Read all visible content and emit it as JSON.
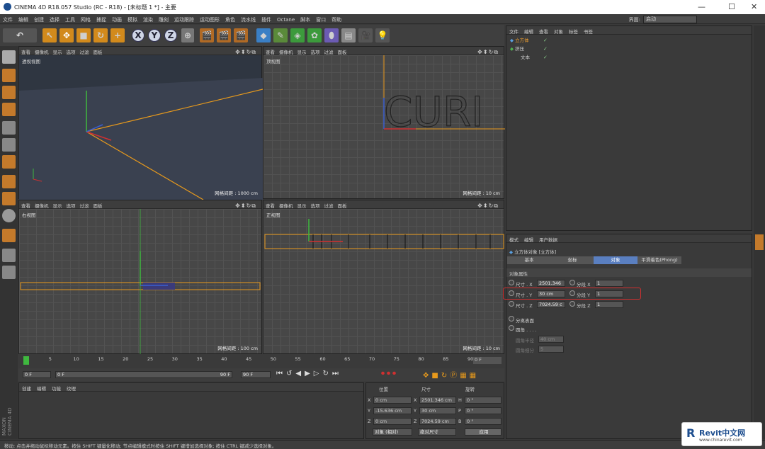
{
  "titlebar": {
    "title": "CINEMA 4D R18.057 Studio (RC - R18) - [未标题 1 *] - 主要",
    "minimize": "—",
    "maximize": "☐",
    "close": "✕"
  },
  "menu": [
    "文件",
    "编辑",
    "创建",
    "选择",
    "工具",
    "网格",
    "捕捉",
    "动画",
    "模拟",
    "渲染",
    "雕刻",
    "运动跟踪",
    "运动图形",
    "角色",
    "流水线",
    "插件",
    "Octane",
    "脚本",
    "窗口",
    "帮助"
  ],
  "layout": {
    "label": "界面:",
    "value": "启动"
  },
  "toolbar": {
    "undo": "↶",
    "axes": [
      "X",
      "Y",
      "Z"
    ]
  },
  "viewport_menu": [
    "查看",
    "摄像机",
    "显示",
    "选项",
    "过滤",
    "面板"
  ],
  "viewports": [
    {
      "name": "透视视图",
      "grid": "网格间距 : 1000 cm"
    },
    {
      "name": "顶视图",
      "grid": "网格间距 : 10 cm",
      "text": "CURI"
    },
    {
      "name": "右视图",
      "grid": "网格间距 : 100 cm"
    },
    {
      "name": "正视图",
      "grid": "网格间距 : 10 cm"
    }
  ],
  "object_manager": {
    "menu": [
      "文件",
      "编辑",
      "查看",
      "对象",
      "标签",
      "书签"
    ],
    "objects": [
      {
        "name": "立方体",
        "active": true
      },
      {
        "name": "挤压",
        "active": false
      },
      {
        "name": "文本",
        "active": false
      }
    ]
  },
  "attributes": {
    "menu": [
      "模式",
      "编辑",
      "用户数据"
    ],
    "object_title": "立方体对象 [立方体]",
    "tabs": [
      "基本",
      "坐标",
      "对象",
      "平滑着色(Phong)"
    ],
    "active_tab": "对象",
    "section": "对象属性",
    "size_x_label": "尺寸 . X",
    "size_x": "2501.346",
    "size_y_label": "尺寸 . Y",
    "size_y": "30 cm",
    "size_z_label": "尺寸 . Z",
    "size_z": "7024.59 c",
    "seg_x_label": "分段 X",
    "seg_x": "1",
    "seg_y_label": "分段 Y",
    "seg_y": "1",
    "seg_z_label": "分段 Z",
    "seg_z": "1",
    "separate": "分离表面",
    "fillet": "圆角 . . . .",
    "fillet_radius_label": "圆角半径",
    "fillet_radius": "40 cm",
    "fillet_sub_label": "圆角细分",
    "fillet_sub": "5",
    "highlight_color": "#d03030"
  },
  "timeline": {
    "ticks": [
      "0",
      "5",
      "10",
      "15",
      "20",
      "25",
      "30",
      "35",
      "40",
      "45",
      "50",
      "55",
      "60",
      "65",
      "70",
      "75",
      "80",
      "85",
      "90"
    ],
    "end": "0 F"
  },
  "transport": {
    "start": "0 F",
    "cur": "0 F",
    "end1": "90 F",
    "end2": "90 F"
  },
  "material_manager": {
    "menu": [
      "创建",
      "编辑",
      "功能",
      "纹理"
    ]
  },
  "coords": {
    "headers": [
      "位置",
      "尺寸",
      "旋转"
    ],
    "rows": [
      {
        "a": "X",
        "p": "0 cm",
        "s": "2501.346 cm",
        "r": "H",
        "rv": "0 °"
      },
      {
        "a": "Y",
        "p": "-15.636 cm",
        "s": "30 cm",
        "r": "P",
        "rv": "0 °"
      },
      {
        "a": "Z",
        "p": "0 cm",
        "s": "7024.59 cm",
        "r": "B",
        "rv": "0 °"
      }
    ],
    "mode1": "对象 (相对)",
    "mode2": "绝对尺寸",
    "apply": "应用"
  },
  "status": "移动: 点击并拖动鼠标移动元素。按住 SHIFT 键量化移动; 节点编辑模式时按住 SHIFT 键增加选择对象; 按住 CTRL 键减少选择对象。",
  "brand": {
    "maxon": "MAXON",
    "c4d": "CINEMA 4D",
    "watermark": "Revit中文网",
    "watermark_url": "www.chinarevit.com"
  }
}
